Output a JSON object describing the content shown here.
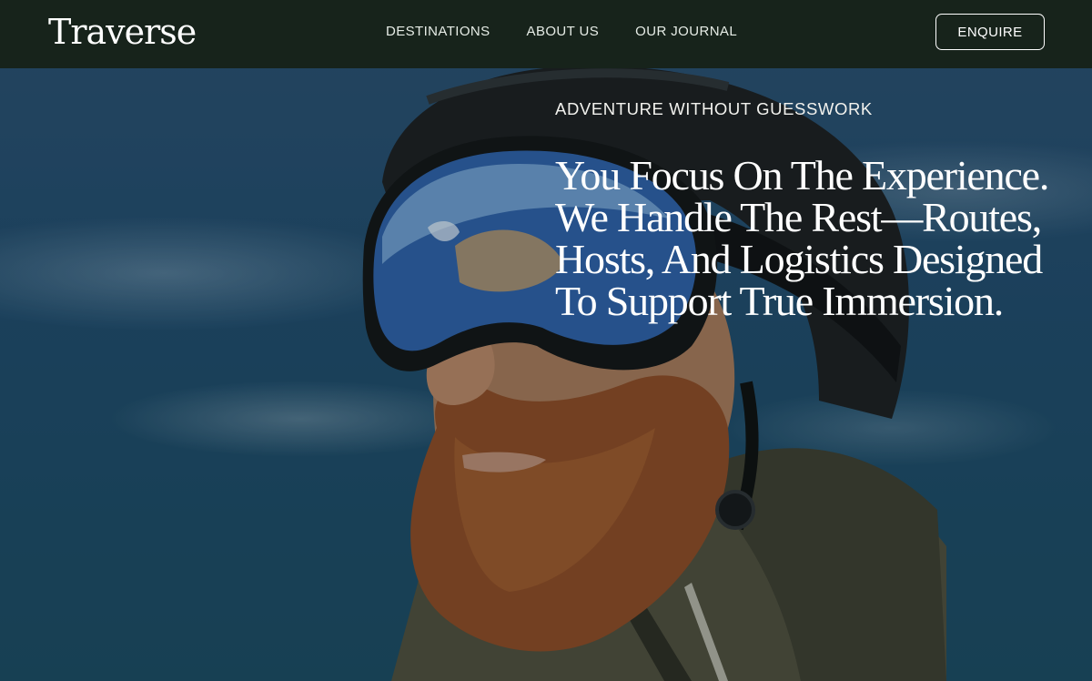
{
  "brand": {
    "name": "Traverse"
  },
  "nav": {
    "links": [
      {
        "label": "DESTINATIONS"
      },
      {
        "label": "ABOUT US"
      },
      {
        "label": "OUR JOURNAL"
      }
    ],
    "cta_label": "ENQUIRE"
  },
  "hero": {
    "eyebrow": "ADVENTURE WITHOUT GUESSWORK",
    "headline": "You Focus On The Experience. We Handle The Rest—Routes, Hosts, And Logistics Designed To Support True Immersion.",
    "image_description_icon": "hero-photo-skier-icon"
  },
  "colors": {
    "nav_background": "#17231b",
    "text": "#ffffff",
    "sky": "#1f4a6c"
  }
}
